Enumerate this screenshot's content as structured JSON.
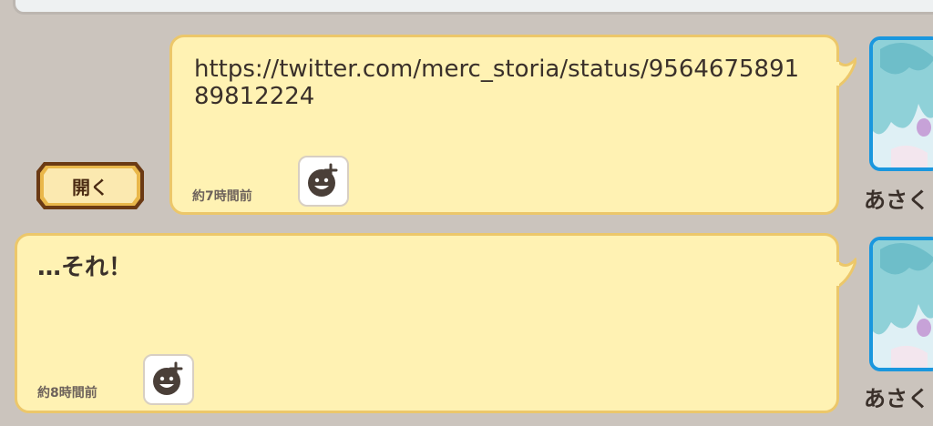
{
  "messages": [
    {
      "text": "https://twitter.com/merc_storia/status/956467589189812224",
      "timestamp": "約7時間前",
      "sender_name": "あさく",
      "action_button_label": "開く"
    },
    {
      "text": "…それ！",
      "timestamp": "約8時間前",
      "sender_name": "あさく"
    }
  ],
  "icons": {
    "reaction": "add-reaction-smiley-icon",
    "avatar": "character-avatar"
  },
  "colors": {
    "background": "#cbc4bd",
    "bubble_fill": "#fff2b3",
    "bubble_border": "#ecc76a",
    "avatar_border": "#1a97de",
    "button_border": "#6b3a14",
    "button_fill": "#fbe9b0"
  }
}
